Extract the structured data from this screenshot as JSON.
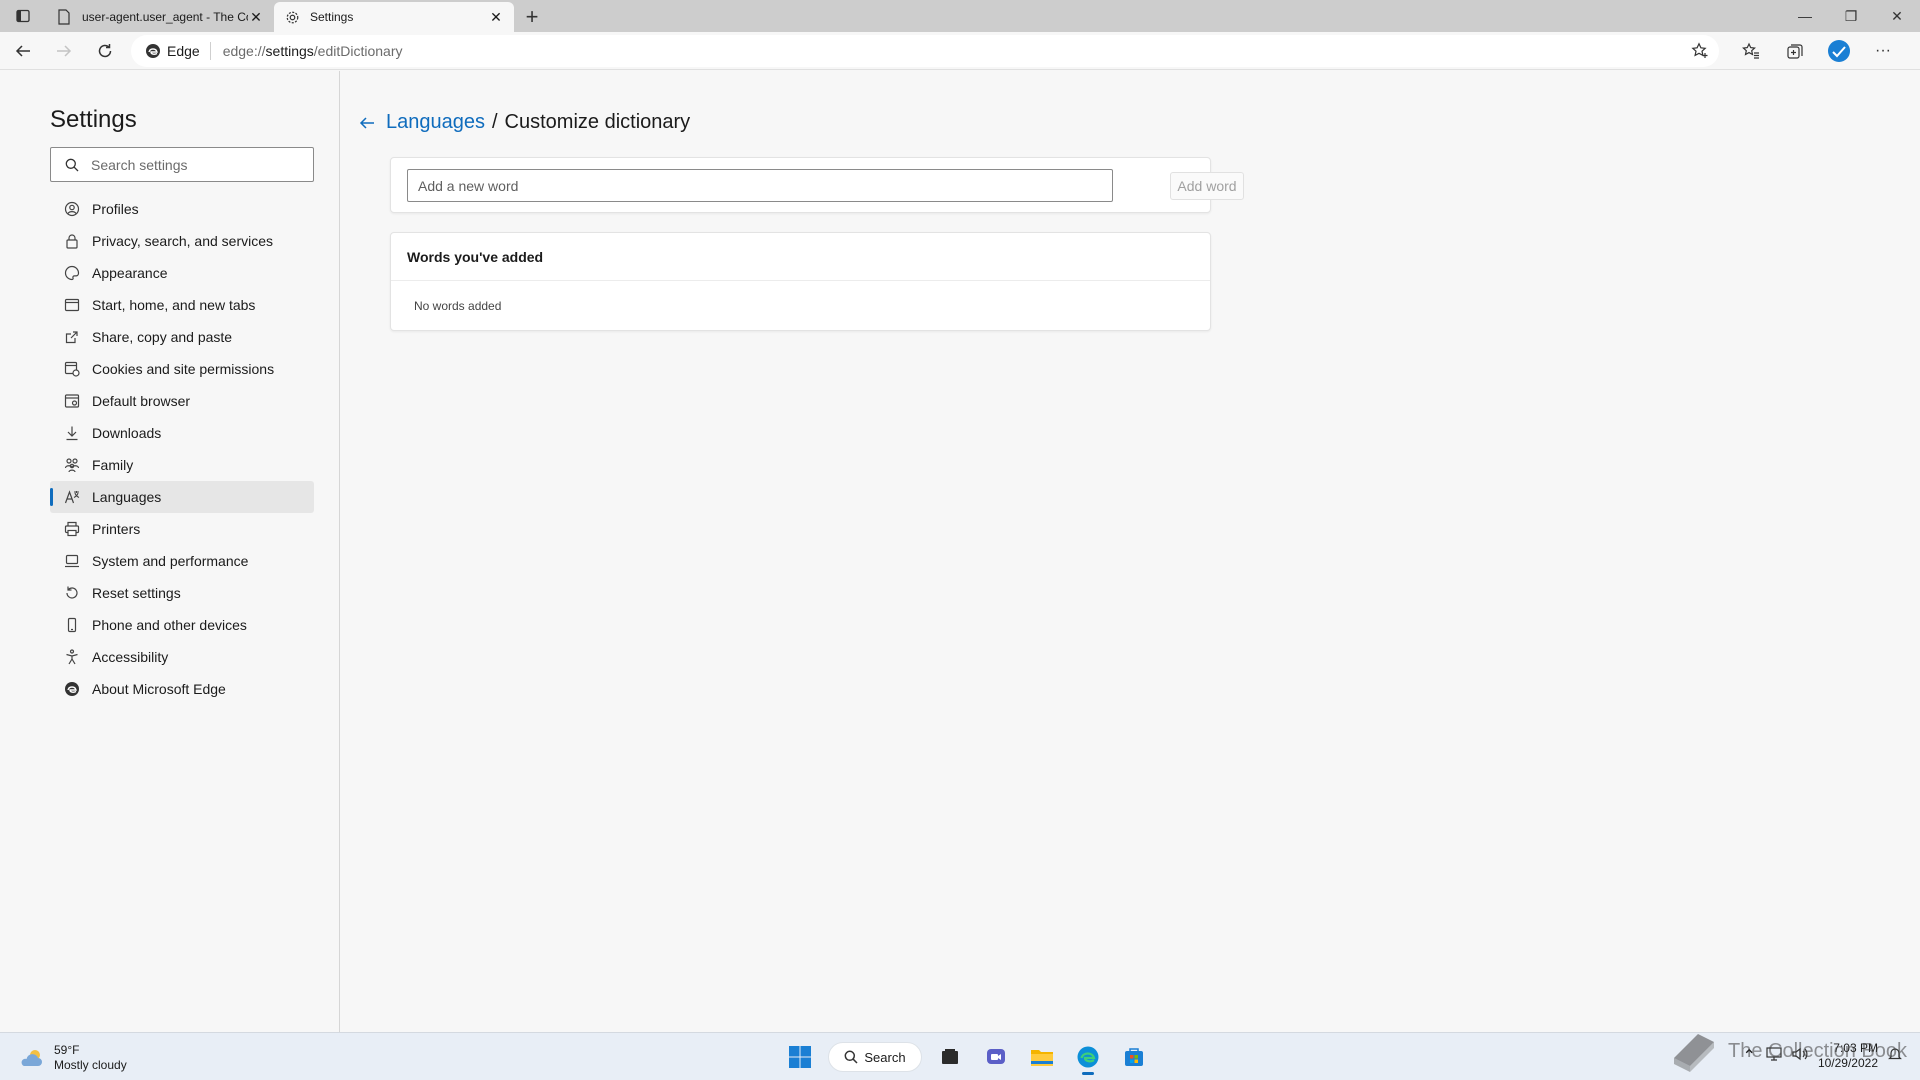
{
  "tabs": [
    {
      "title": "user-agent.user_agent - The Coll",
      "active": false,
      "icon": "page-icon"
    },
    {
      "title": "Settings",
      "active": true,
      "icon": "gear-icon"
    }
  ],
  "toolbar": {
    "edge_label": "Edge",
    "url_prefix": "edge://",
    "url_host": "settings",
    "url_path": "/editDictionary"
  },
  "sidebar": {
    "title": "Settings",
    "search_placeholder": "Search settings",
    "items": [
      {
        "label": "Profiles",
        "icon": "profile-icon"
      },
      {
        "label": "Privacy, search, and services",
        "icon": "lock-icon"
      },
      {
        "label": "Appearance",
        "icon": "appearance-icon"
      },
      {
        "label": "Start, home, and new tabs",
        "icon": "home-tabs-icon"
      },
      {
        "label": "Share, copy and paste",
        "icon": "share-icon"
      },
      {
        "label": "Cookies and site permissions",
        "icon": "cookies-icon"
      },
      {
        "label": "Default browser",
        "icon": "browser-icon"
      },
      {
        "label": "Downloads",
        "icon": "download-icon"
      },
      {
        "label": "Family",
        "icon": "family-icon"
      },
      {
        "label": "Languages",
        "icon": "languages-icon",
        "selected": true
      },
      {
        "label": "Printers",
        "icon": "printer-icon"
      },
      {
        "label": "System and performance",
        "icon": "system-icon"
      },
      {
        "label": "Reset settings",
        "icon": "reset-icon"
      },
      {
        "label": "Phone and other devices",
        "icon": "phone-icon"
      },
      {
        "label": "Accessibility",
        "icon": "accessibility-icon"
      },
      {
        "label": "About Microsoft Edge",
        "icon": "edge-logo-icon"
      }
    ]
  },
  "main": {
    "breadcrumb_parent": "Languages",
    "breadcrumb_sep": "/",
    "breadcrumb_current": "Customize dictionary",
    "add_placeholder": "Add a new word",
    "add_button": "Add word",
    "words_header": "Words you've added",
    "empty_text": "No words added"
  },
  "taskbar": {
    "temperature": "59°F",
    "condition": "Mostly cloudy",
    "search_label": "Search",
    "time": "7:03 PM",
    "date": "10/29/2022"
  },
  "watermark": "The Collection Book",
  "colors": {
    "accent": "#0f6cbd",
    "taskbar": "#e8eef6"
  }
}
